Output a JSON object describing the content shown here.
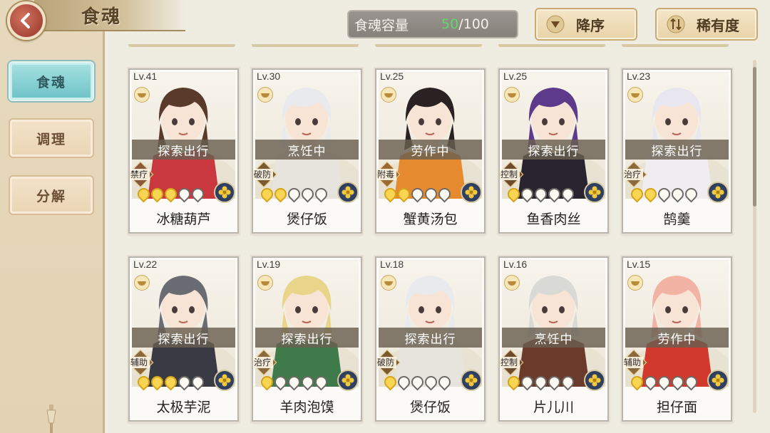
{
  "header": {
    "title": "食魂",
    "capacity_label": "食魂容量",
    "capacity_current": "50",
    "capacity_max": "/100",
    "sort_order_label": "降序",
    "sort_key_label": "稀有度"
  },
  "sidebar": {
    "tabs": [
      {
        "label": "食魂",
        "active": true
      },
      {
        "label": "调理",
        "active": false
      },
      {
        "label": "分解",
        "active": false
      }
    ]
  },
  "colors": {
    "active_tab": "#6cc2c6",
    "capacity_current": "#5fd86a",
    "back_button": "#a8473a",
    "star_on": "#f8d552"
  },
  "cards": [
    {
      "level": "Lv.41",
      "status": "探索出行",
      "role": "禁疗",
      "stars": 3,
      "name": "冰糖葫芦",
      "element_icon": "moon-flower-icon",
      "hair": "#5a3a2a",
      "outfit": "#c9383f"
    },
    {
      "level": "Lv.30",
      "status": "烹饪中",
      "role": "破防",
      "stars": 2,
      "name": "煲仔饭",
      "element_icon": "moon-flower-icon",
      "hair": "#e9eaee",
      "outfit": "#e6e4dc"
    },
    {
      "level": "Lv.25",
      "status": "劳作中",
      "role": "附毒",
      "stars": 2,
      "name": "蟹黄汤包",
      "element_icon": "moon-flower-icon",
      "hair": "#2a2222",
      "outfit": "#e58a2f"
    },
    {
      "level": "Lv.25",
      "status": "探索出行",
      "role": "控制",
      "stars": 1,
      "name": "鱼香肉丝",
      "element_icon": "moon-flower-icon",
      "hair": "#5d3b8a",
      "outfit": "#2a2430"
    },
    {
      "level": "Lv.23",
      "status": "探索出行",
      "role": "治疗",
      "stars": 2,
      "name": "鹄羹",
      "element_icon": "moon-flower-icon",
      "hair": "#e8e6ef",
      "outfit": "#f1ecf0"
    },
    {
      "level": "Lv.22",
      "status": "探索出行",
      "role": "辅助",
      "stars": 3,
      "name": "太极芋泥",
      "element_icon": "moon-flower-icon",
      "hair": "#6a6c74",
      "outfit": "#3a3a44"
    },
    {
      "level": "Lv.19",
      "status": "探索出行",
      "role": "治疗",
      "stars": 1,
      "name": "羊肉泡馍",
      "element_icon": "moon-flower-icon",
      "hair": "#e9d58a",
      "outfit": "#3f7a4a"
    },
    {
      "level": "Lv.18",
      "status": "探索出行",
      "role": "破防",
      "stars": 1,
      "name": "煲仔饭",
      "element_icon": "moon-flower-icon",
      "hair": "#e9eaee",
      "outfit": "#e6e4dc"
    },
    {
      "level": "Lv.16",
      "status": "烹饪中",
      "role": "控制",
      "stars": 1,
      "name": "片儿川",
      "element_icon": "moon-flower-icon",
      "hair": "#d9d9d6",
      "outfit": "#6a3a2a"
    },
    {
      "level": "Lv.15",
      "status": "劳作中",
      "role": "辅助",
      "stars": 1,
      "name": "担仔面",
      "element_icon": "moon-flower-icon",
      "hair": "#f2b3a4",
      "outfit": "#d0392c"
    }
  ]
}
